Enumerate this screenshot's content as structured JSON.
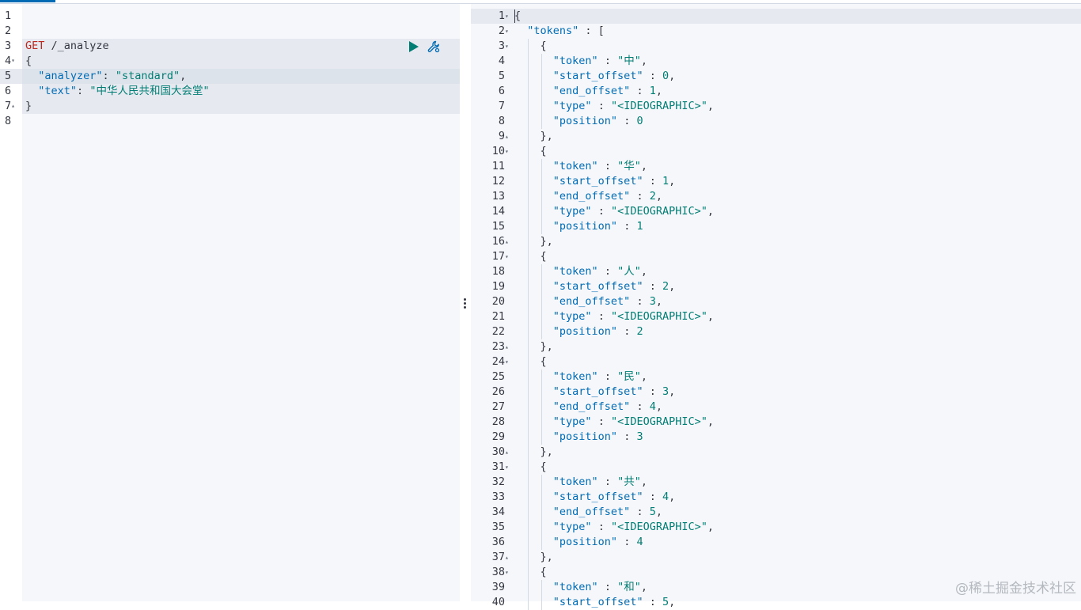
{
  "request": {
    "method": "GET",
    "url": "/_analyze",
    "lines": [
      {
        "n": "1",
        "fold": "",
        "parts": []
      },
      {
        "n": "2",
        "fold": "",
        "parts": []
      },
      {
        "n": "3",
        "fold": "",
        "parts": [
          {
            "c": "c-method",
            "t": "GET"
          },
          {
            "c": "c-url",
            "t": " /_analyze"
          }
        ]
      },
      {
        "n": "4",
        "fold": "▾",
        "parts": [
          {
            "c": "c-punc",
            "t": "{"
          }
        ]
      },
      {
        "n": "5",
        "fold": "",
        "parts": [
          {
            "c": "c-punc",
            "t": "  "
          },
          {
            "c": "c-key",
            "t": "\"analyzer\""
          },
          {
            "c": "c-punc",
            "t": ": "
          },
          {
            "c": "c-str",
            "t": "\"standard\""
          },
          {
            "c": "c-punc",
            "t": ","
          }
        ]
      },
      {
        "n": "6",
        "fold": "",
        "parts": [
          {
            "c": "c-punc",
            "t": "  "
          },
          {
            "c": "c-key",
            "t": "\"text\""
          },
          {
            "c": "c-punc",
            "t": ": "
          },
          {
            "c": "c-str",
            "t": "\"中华人民共和国大会堂\""
          }
        ]
      },
      {
        "n": "7",
        "fold": "▴",
        "parts": [
          {
            "c": "c-punc",
            "t": "}"
          }
        ]
      },
      {
        "n": "8",
        "fold": "",
        "parts": []
      }
    ]
  },
  "response": {
    "lines": [
      {
        "n": "1",
        "fold": "▾",
        "indent": 0,
        "parts": [
          {
            "c": "c-punc",
            "t": "{"
          }
        ]
      },
      {
        "n": "2",
        "fold": "▾",
        "indent": 1,
        "parts": [
          {
            "c": "c-key",
            "t": "\"tokens\""
          },
          {
            "c": "c-punc",
            "t": " : ["
          }
        ]
      },
      {
        "n": "3",
        "fold": "▾",
        "indent": 2,
        "parts": [
          {
            "c": "c-punc",
            "t": "{"
          }
        ]
      },
      {
        "n": "4",
        "fold": "",
        "indent": 3,
        "parts": [
          {
            "c": "c-key",
            "t": "\"token\""
          },
          {
            "c": "c-punc",
            "t": " : "
          },
          {
            "c": "c-str",
            "t": "\"中\""
          },
          {
            "c": "c-punc",
            "t": ","
          }
        ]
      },
      {
        "n": "5",
        "fold": "",
        "indent": 3,
        "parts": [
          {
            "c": "c-key",
            "t": "\"start_offset\""
          },
          {
            "c": "c-punc",
            "t": " : "
          },
          {
            "c": "c-num",
            "t": "0"
          },
          {
            "c": "c-punc",
            "t": ","
          }
        ]
      },
      {
        "n": "6",
        "fold": "",
        "indent": 3,
        "parts": [
          {
            "c": "c-key",
            "t": "\"end_offset\""
          },
          {
            "c": "c-punc",
            "t": " : "
          },
          {
            "c": "c-num",
            "t": "1"
          },
          {
            "c": "c-punc",
            "t": ","
          }
        ]
      },
      {
        "n": "7",
        "fold": "",
        "indent": 3,
        "parts": [
          {
            "c": "c-key",
            "t": "\"type\""
          },
          {
            "c": "c-punc",
            "t": " : "
          },
          {
            "c": "c-str",
            "t": "\"<IDEOGRAPHIC>\""
          },
          {
            "c": "c-punc",
            "t": ","
          }
        ]
      },
      {
        "n": "8",
        "fold": "",
        "indent": 3,
        "parts": [
          {
            "c": "c-key",
            "t": "\"position\""
          },
          {
            "c": "c-punc",
            "t": " : "
          },
          {
            "c": "c-num",
            "t": "0"
          }
        ]
      },
      {
        "n": "9",
        "fold": "▴",
        "indent": 2,
        "parts": [
          {
            "c": "c-punc",
            "t": "},"
          }
        ]
      },
      {
        "n": "10",
        "fold": "▾",
        "indent": 2,
        "parts": [
          {
            "c": "c-punc",
            "t": "{"
          }
        ]
      },
      {
        "n": "11",
        "fold": "",
        "indent": 3,
        "parts": [
          {
            "c": "c-key",
            "t": "\"token\""
          },
          {
            "c": "c-punc",
            "t": " : "
          },
          {
            "c": "c-str",
            "t": "\"华\""
          },
          {
            "c": "c-punc",
            "t": ","
          }
        ]
      },
      {
        "n": "12",
        "fold": "",
        "indent": 3,
        "parts": [
          {
            "c": "c-key",
            "t": "\"start_offset\""
          },
          {
            "c": "c-punc",
            "t": " : "
          },
          {
            "c": "c-num",
            "t": "1"
          },
          {
            "c": "c-punc",
            "t": ","
          }
        ]
      },
      {
        "n": "13",
        "fold": "",
        "indent": 3,
        "parts": [
          {
            "c": "c-key",
            "t": "\"end_offset\""
          },
          {
            "c": "c-punc",
            "t": " : "
          },
          {
            "c": "c-num",
            "t": "2"
          },
          {
            "c": "c-punc",
            "t": ","
          }
        ]
      },
      {
        "n": "14",
        "fold": "",
        "indent": 3,
        "parts": [
          {
            "c": "c-key",
            "t": "\"type\""
          },
          {
            "c": "c-punc",
            "t": " : "
          },
          {
            "c": "c-str",
            "t": "\"<IDEOGRAPHIC>\""
          },
          {
            "c": "c-punc",
            "t": ","
          }
        ]
      },
      {
        "n": "15",
        "fold": "",
        "indent": 3,
        "parts": [
          {
            "c": "c-key",
            "t": "\"position\""
          },
          {
            "c": "c-punc",
            "t": " : "
          },
          {
            "c": "c-num",
            "t": "1"
          }
        ]
      },
      {
        "n": "16",
        "fold": "▴",
        "indent": 2,
        "parts": [
          {
            "c": "c-punc",
            "t": "},"
          }
        ]
      },
      {
        "n": "17",
        "fold": "▾",
        "indent": 2,
        "parts": [
          {
            "c": "c-punc",
            "t": "{"
          }
        ]
      },
      {
        "n": "18",
        "fold": "",
        "indent": 3,
        "parts": [
          {
            "c": "c-key",
            "t": "\"token\""
          },
          {
            "c": "c-punc",
            "t": " : "
          },
          {
            "c": "c-str",
            "t": "\"人\""
          },
          {
            "c": "c-punc",
            "t": ","
          }
        ]
      },
      {
        "n": "19",
        "fold": "",
        "indent": 3,
        "parts": [
          {
            "c": "c-key",
            "t": "\"start_offset\""
          },
          {
            "c": "c-punc",
            "t": " : "
          },
          {
            "c": "c-num",
            "t": "2"
          },
          {
            "c": "c-punc",
            "t": ","
          }
        ]
      },
      {
        "n": "20",
        "fold": "",
        "indent": 3,
        "parts": [
          {
            "c": "c-key",
            "t": "\"end_offset\""
          },
          {
            "c": "c-punc",
            "t": " : "
          },
          {
            "c": "c-num",
            "t": "3"
          },
          {
            "c": "c-punc",
            "t": ","
          }
        ]
      },
      {
        "n": "21",
        "fold": "",
        "indent": 3,
        "parts": [
          {
            "c": "c-key",
            "t": "\"type\""
          },
          {
            "c": "c-punc",
            "t": " : "
          },
          {
            "c": "c-str",
            "t": "\"<IDEOGRAPHIC>\""
          },
          {
            "c": "c-punc",
            "t": ","
          }
        ]
      },
      {
        "n": "22",
        "fold": "",
        "indent": 3,
        "parts": [
          {
            "c": "c-key",
            "t": "\"position\""
          },
          {
            "c": "c-punc",
            "t": " : "
          },
          {
            "c": "c-num",
            "t": "2"
          }
        ]
      },
      {
        "n": "23",
        "fold": "▴",
        "indent": 2,
        "parts": [
          {
            "c": "c-punc",
            "t": "},"
          }
        ]
      },
      {
        "n": "24",
        "fold": "▾",
        "indent": 2,
        "parts": [
          {
            "c": "c-punc",
            "t": "{"
          }
        ]
      },
      {
        "n": "25",
        "fold": "",
        "indent": 3,
        "parts": [
          {
            "c": "c-key",
            "t": "\"token\""
          },
          {
            "c": "c-punc",
            "t": " : "
          },
          {
            "c": "c-str",
            "t": "\"民\""
          },
          {
            "c": "c-punc",
            "t": ","
          }
        ]
      },
      {
        "n": "26",
        "fold": "",
        "indent": 3,
        "parts": [
          {
            "c": "c-key",
            "t": "\"start_offset\""
          },
          {
            "c": "c-punc",
            "t": " : "
          },
          {
            "c": "c-num",
            "t": "3"
          },
          {
            "c": "c-punc",
            "t": ","
          }
        ]
      },
      {
        "n": "27",
        "fold": "",
        "indent": 3,
        "parts": [
          {
            "c": "c-key",
            "t": "\"end_offset\""
          },
          {
            "c": "c-punc",
            "t": " : "
          },
          {
            "c": "c-num",
            "t": "4"
          },
          {
            "c": "c-punc",
            "t": ","
          }
        ]
      },
      {
        "n": "28",
        "fold": "",
        "indent": 3,
        "parts": [
          {
            "c": "c-key",
            "t": "\"type\""
          },
          {
            "c": "c-punc",
            "t": " : "
          },
          {
            "c": "c-str",
            "t": "\"<IDEOGRAPHIC>\""
          },
          {
            "c": "c-punc",
            "t": ","
          }
        ]
      },
      {
        "n": "29",
        "fold": "",
        "indent": 3,
        "parts": [
          {
            "c": "c-key",
            "t": "\"position\""
          },
          {
            "c": "c-punc",
            "t": " : "
          },
          {
            "c": "c-num",
            "t": "3"
          }
        ]
      },
      {
        "n": "30",
        "fold": "▴",
        "indent": 2,
        "parts": [
          {
            "c": "c-punc",
            "t": "},"
          }
        ]
      },
      {
        "n": "31",
        "fold": "▾",
        "indent": 2,
        "parts": [
          {
            "c": "c-punc",
            "t": "{"
          }
        ]
      },
      {
        "n": "32",
        "fold": "",
        "indent": 3,
        "parts": [
          {
            "c": "c-key",
            "t": "\"token\""
          },
          {
            "c": "c-punc",
            "t": " : "
          },
          {
            "c": "c-str",
            "t": "\"共\""
          },
          {
            "c": "c-punc",
            "t": ","
          }
        ]
      },
      {
        "n": "33",
        "fold": "",
        "indent": 3,
        "parts": [
          {
            "c": "c-key",
            "t": "\"start_offset\""
          },
          {
            "c": "c-punc",
            "t": " : "
          },
          {
            "c": "c-num",
            "t": "4"
          },
          {
            "c": "c-punc",
            "t": ","
          }
        ]
      },
      {
        "n": "34",
        "fold": "",
        "indent": 3,
        "parts": [
          {
            "c": "c-key",
            "t": "\"end_offset\""
          },
          {
            "c": "c-punc",
            "t": " : "
          },
          {
            "c": "c-num",
            "t": "5"
          },
          {
            "c": "c-punc",
            "t": ","
          }
        ]
      },
      {
        "n": "35",
        "fold": "",
        "indent": 3,
        "parts": [
          {
            "c": "c-key",
            "t": "\"type\""
          },
          {
            "c": "c-punc",
            "t": " : "
          },
          {
            "c": "c-str",
            "t": "\"<IDEOGRAPHIC>\""
          },
          {
            "c": "c-punc",
            "t": ","
          }
        ]
      },
      {
        "n": "36",
        "fold": "",
        "indent": 3,
        "parts": [
          {
            "c": "c-key",
            "t": "\"position\""
          },
          {
            "c": "c-punc",
            "t": " : "
          },
          {
            "c": "c-num",
            "t": "4"
          }
        ]
      },
      {
        "n": "37",
        "fold": "▴",
        "indent": 2,
        "parts": [
          {
            "c": "c-punc",
            "t": "},"
          }
        ]
      },
      {
        "n": "38",
        "fold": "▾",
        "indent": 2,
        "parts": [
          {
            "c": "c-punc",
            "t": "{"
          }
        ]
      },
      {
        "n": "39",
        "fold": "",
        "indent": 3,
        "parts": [
          {
            "c": "c-key",
            "t": "\"token\""
          },
          {
            "c": "c-punc",
            "t": " : "
          },
          {
            "c": "c-str",
            "t": "\"和\""
          },
          {
            "c": "c-punc",
            "t": ","
          }
        ]
      },
      {
        "n": "40",
        "fold": "",
        "indent": 3,
        "parts": [
          {
            "c": "c-key",
            "t": "\"start_offset\""
          },
          {
            "c": "c-punc",
            "t": " : "
          },
          {
            "c": "c-num",
            "t": "5"
          },
          {
            "c": "c-punc",
            "t": ","
          }
        ]
      }
    ]
  },
  "watermark": "@稀土掘金技术社区",
  "icons": {
    "run": "play-icon",
    "settings": "wrench-icon"
  },
  "colors": {
    "method": "#bd271e",
    "key": "#006bb4",
    "string": "#017d73",
    "run_button": "#017d73",
    "editor_bg": "#f5f7fa"
  }
}
